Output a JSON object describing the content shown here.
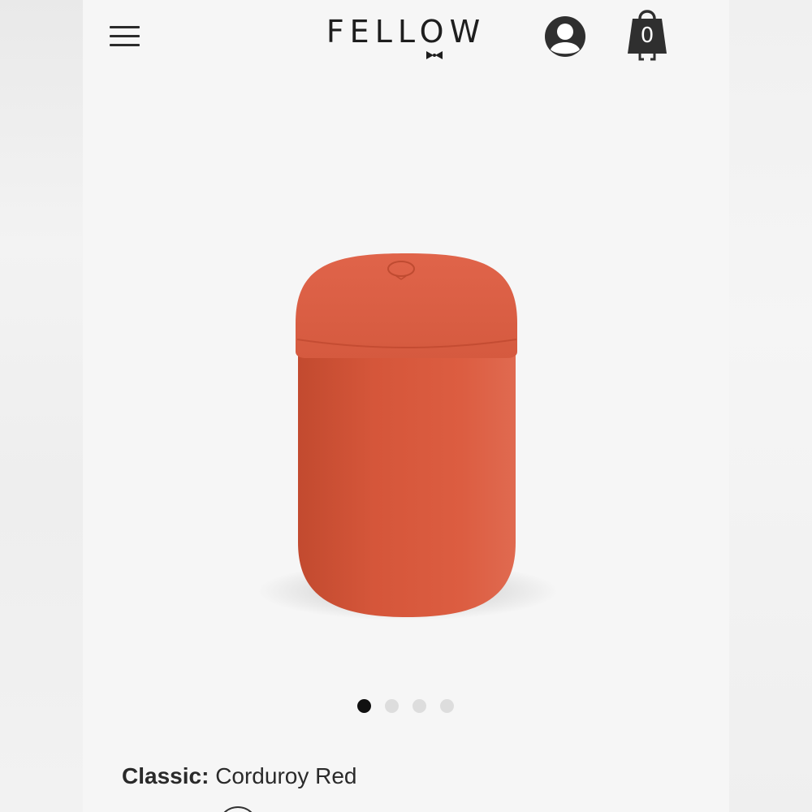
{
  "header": {
    "brand": "FELLOW",
    "cart_count": "0",
    "icons": {
      "menu": "hamburger-menu-icon",
      "account": "user-account-icon",
      "cart": "shopping-bag-icon",
      "logo_mark": "bow-tie-icon"
    }
  },
  "product": {
    "image": "orange-red-insulated-canister",
    "color_hex": "#d85a3e"
  },
  "carousel": {
    "count": 4,
    "active_index": 0
  },
  "variant": {
    "label": "Classic:",
    "value": "Corduroy Red"
  },
  "colors": {
    "accent": "#d85a3e",
    "text": "#2a2a2a",
    "background": "#f6f6f6"
  }
}
